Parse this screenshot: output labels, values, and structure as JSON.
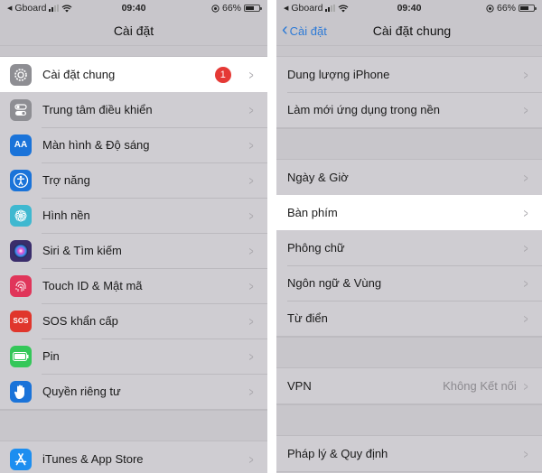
{
  "status_bar": {
    "carrier": "Gboard",
    "back_arrow": "◀",
    "time": "09:40",
    "battery_percent": "66%",
    "battery_level": 0.66
  },
  "left_screen": {
    "title": "Cài đặt",
    "groups": [
      {
        "items": [
          {
            "label": "Cài đặt chung",
            "icon": "gear-icon",
            "icon_color": "#8e8e93",
            "badge": "1",
            "highlighted": true
          },
          {
            "label": "Trung tâm điều khiển",
            "icon": "toggles-icon",
            "icon_color": "#8e8e93"
          },
          {
            "label": "Màn hình & Độ sáng",
            "icon": "text-size-icon",
            "icon_glyph": "AA",
            "icon_color": "#1a73d9"
          },
          {
            "label": "Trợ năng",
            "icon": "accessibility-icon",
            "icon_color": "#1a73d9"
          },
          {
            "label": "Hình nền",
            "icon": "wallpaper-icon",
            "icon_color": "#3fb8d0"
          },
          {
            "label": "Siri & Tìm kiếm",
            "icon": "siri-icon",
            "icon_color": "#3a2d6b"
          },
          {
            "label": "Touch ID & Mật mã",
            "icon": "fingerprint-icon",
            "icon_color": "#e0355a"
          },
          {
            "label": "SOS khẩn cấp",
            "icon": "sos-icon",
            "icon_glyph": "SOS",
            "icon_color": "#e0362c"
          },
          {
            "label": "Pin",
            "icon": "battery-icon",
            "icon_color": "#34c759"
          },
          {
            "label": "Quyền riêng tư",
            "icon": "hand-icon",
            "icon_color": "#1a73d9"
          }
        ]
      },
      {
        "items": [
          {
            "label": "iTunes & App Store",
            "icon": "app-store-icon",
            "icon_color": "#1c8ef0"
          }
        ]
      }
    ]
  },
  "right_screen": {
    "back_label": "Cài đặt",
    "title": "Cài đặt chung",
    "groups": [
      {
        "items": [
          {
            "label": "Dung lượng iPhone"
          },
          {
            "label": "Làm mới ứng dụng trong nền"
          }
        ]
      },
      {
        "items": [
          {
            "label": "Ngày & Giờ"
          },
          {
            "label": "Bàn phím",
            "highlighted": true
          },
          {
            "label": "Phông chữ"
          },
          {
            "label": "Ngôn ngữ & Vùng"
          },
          {
            "label": "Từ điển"
          }
        ]
      },
      {
        "items": [
          {
            "label": "VPN",
            "detail": "Không Kết nối"
          }
        ]
      },
      {
        "items": [
          {
            "label": "Pháp lý & Quy định"
          }
        ]
      }
    ]
  },
  "chevron_glyph": ">"
}
